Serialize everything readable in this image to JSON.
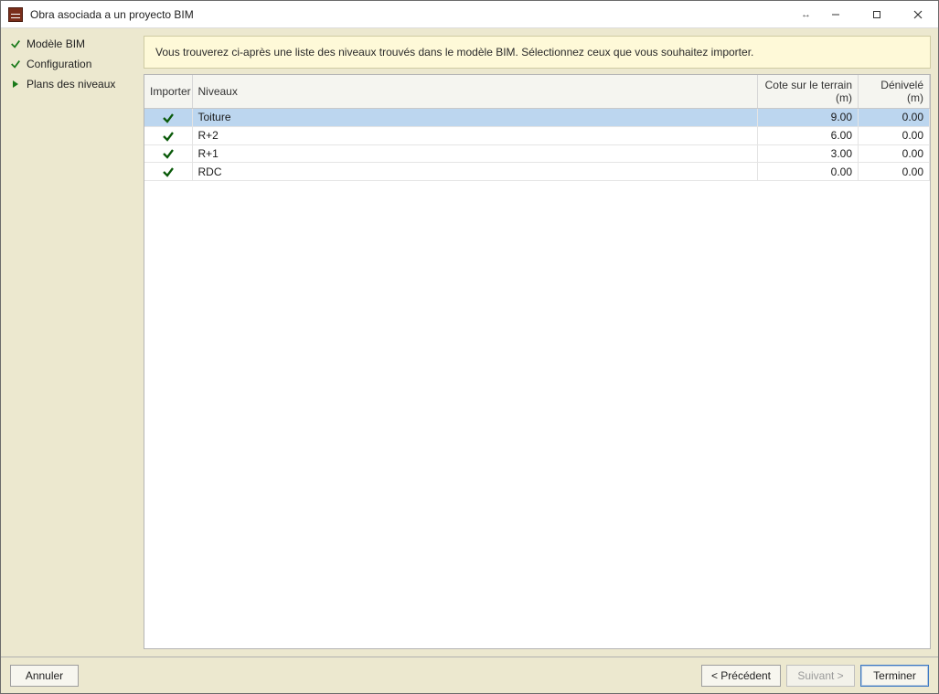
{
  "window": {
    "title": "Obra asociada a un proyecto BIM"
  },
  "sidebar": {
    "steps": [
      {
        "label": "Modèle BIM",
        "state": "done"
      },
      {
        "label": "Configuration",
        "state": "done"
      },
      {
        "label": "Plans des niveaux",
        "state": "current"
      }
    ]
  },
  "banner": {
    "text": "Vous trouverez ci-après une liste des niveaux trouvés dans le modèle BIM. Sélectionnez ceux que vous souhaitez importer."
  },
  "grid": {
    "headers": {
      "import": "Importer",
      "niveau": "Niveaux",
      "cote": "Cote sur le terrain (m)",
      "denivele": "Dénivelé (m)"
    },
    "rows": [
      {
        "import": true,
        "niveau": "Toiture",
        "cote": "9.00",
        "denivele": "0.00",
        "selected": true
      },
      {
        "import": true,
        "niveau": "R+2",
        "cote": "6.00",
        "denivele": "0.00",
        "selected": false
      },
      {
        "import": true,
        "niveau": "R+1",
        "cote": "3.00",
        "denivele": "0.00",
        "selected": false
      },
      {
        "import": true,
        "niveau": "RDC",
        "cote": "0.00",
        "denivele": "0.00",
        "selected": false
      }
    ]
  },
  "footer": {
    "cancel": "Annuler",
    "previous": "< Précédent",
    "next": "Suivant >",
    "finish": "Terminer",
    "next_enabled": false
  }
}
